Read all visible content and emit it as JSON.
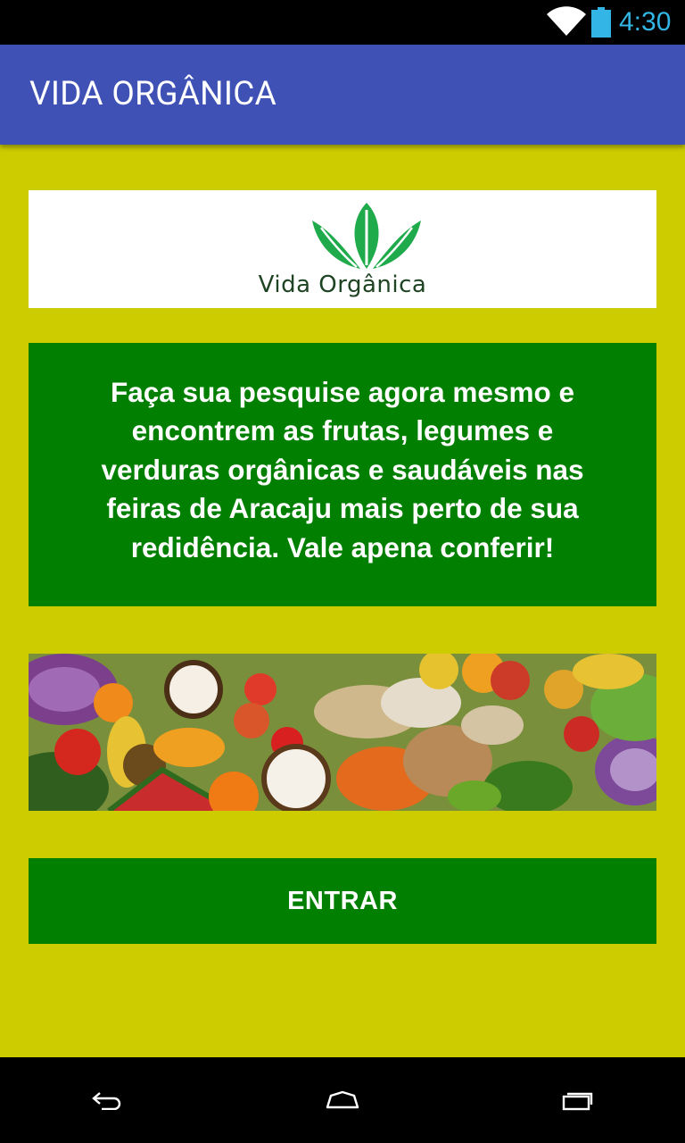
{
  "status_bar": {
    "time": "4:30",
    "icons": [
      "wifi-icon",
      "battery-icon"
    ]
  },
  "app_bar": {
    "title": "VIDA ORGÂNICA"
  },
  "logo": {
    "text": "Vida Orgânica"
  },
  "message": {
    "text": "Faça sua pesquise agora mesmo e encontrem as frutas, legumes e verduras orgânicas e saudáveis nas feiras de Aracaju mais perto de sua redidência. Vale apena conferir!"
  },
  "banner": {
    "image": "fruits-vegetables-image"
  },
  "enter_button": {
    "label": "ENTRAR"
  },
  "nav_bar": {
    "icons": [
      "back-icon",
      "home-icon",
      "recents-icon"
    ]
  },
  "colors": {
    "background": "#cccc00",
    "app_bar": "#3f51b5",
    "green": "#007f00",
    "status_time": "#33b5e5"
  }
}
